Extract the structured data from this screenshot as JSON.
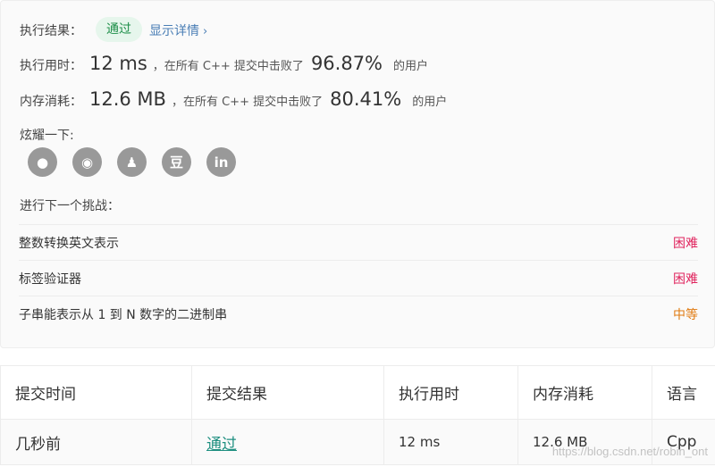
{
  "result": {
    "label": "执行结果：",
    "badge": "通过",
    "detail_link": "显示详情",
    "detail_chevron": "›"
  },
  "runtime": {
    "label": "执行用时：",
    "value": "12 ms",
    "middle": "，在所有 C++ 提交中击败了",
    "percent": "96.87%",
    "tail": "的用户"
  },
  "memory": {
    "label": "内存消耗：",
    "value": "12.6 MB",
    "middle": "，在所有 C++ 提交中击败了",
    "percent": "80.41%",
    "tail": "的用户"
  },
  "share": {
    "label": "炫耀一下:",
    "icons": [
      {
        "name": "wechat-icon",
        "glyph": "●"
      },
      {
        "name": "weibo-icon",
        "glyph": "◉"
      },
      {
        "name": "qq-icon",
        "glyph": "♟"
      },
      {
        "name": "douban-icon",
        "glyph": "豆"
      },
      {
        "name": "linkedin-icon",
        "glyph": "in"
      }
    ]
  },
  "next": {
    "label": "进行下一个挑战：",
    "challenges": [
      {
        "title": "整数转换英文表示",
        "difficulty": "困难"
      },
      {
        "title": "标签验证器",
        "difficulty": "困难"
      },
      {
        "title": "子串能表示从 1 到 N 数字的二进制串",
        "difficulty": "中等"
      }
    ]
  },
  "colors": {
    "hard": "#e0245e",
    "medium": "#e07a10",
    "pass": "#1e8f49"
  },
  "submissions": {
    "headers": [
      "提交时间",
      "提交结果",
      "执行用时",
      "内存消耗",
      "语言"
    ],
    "rows": [
      {
        "time": "几秒前",
        "status": "通过",
        "runtime": "12 ms",
        "memory": "12.6 MB",
        "language": "Cpp"
      }
    ]
  },
  "watermark": "https://blog.csdn.net/robin_ont"
}
